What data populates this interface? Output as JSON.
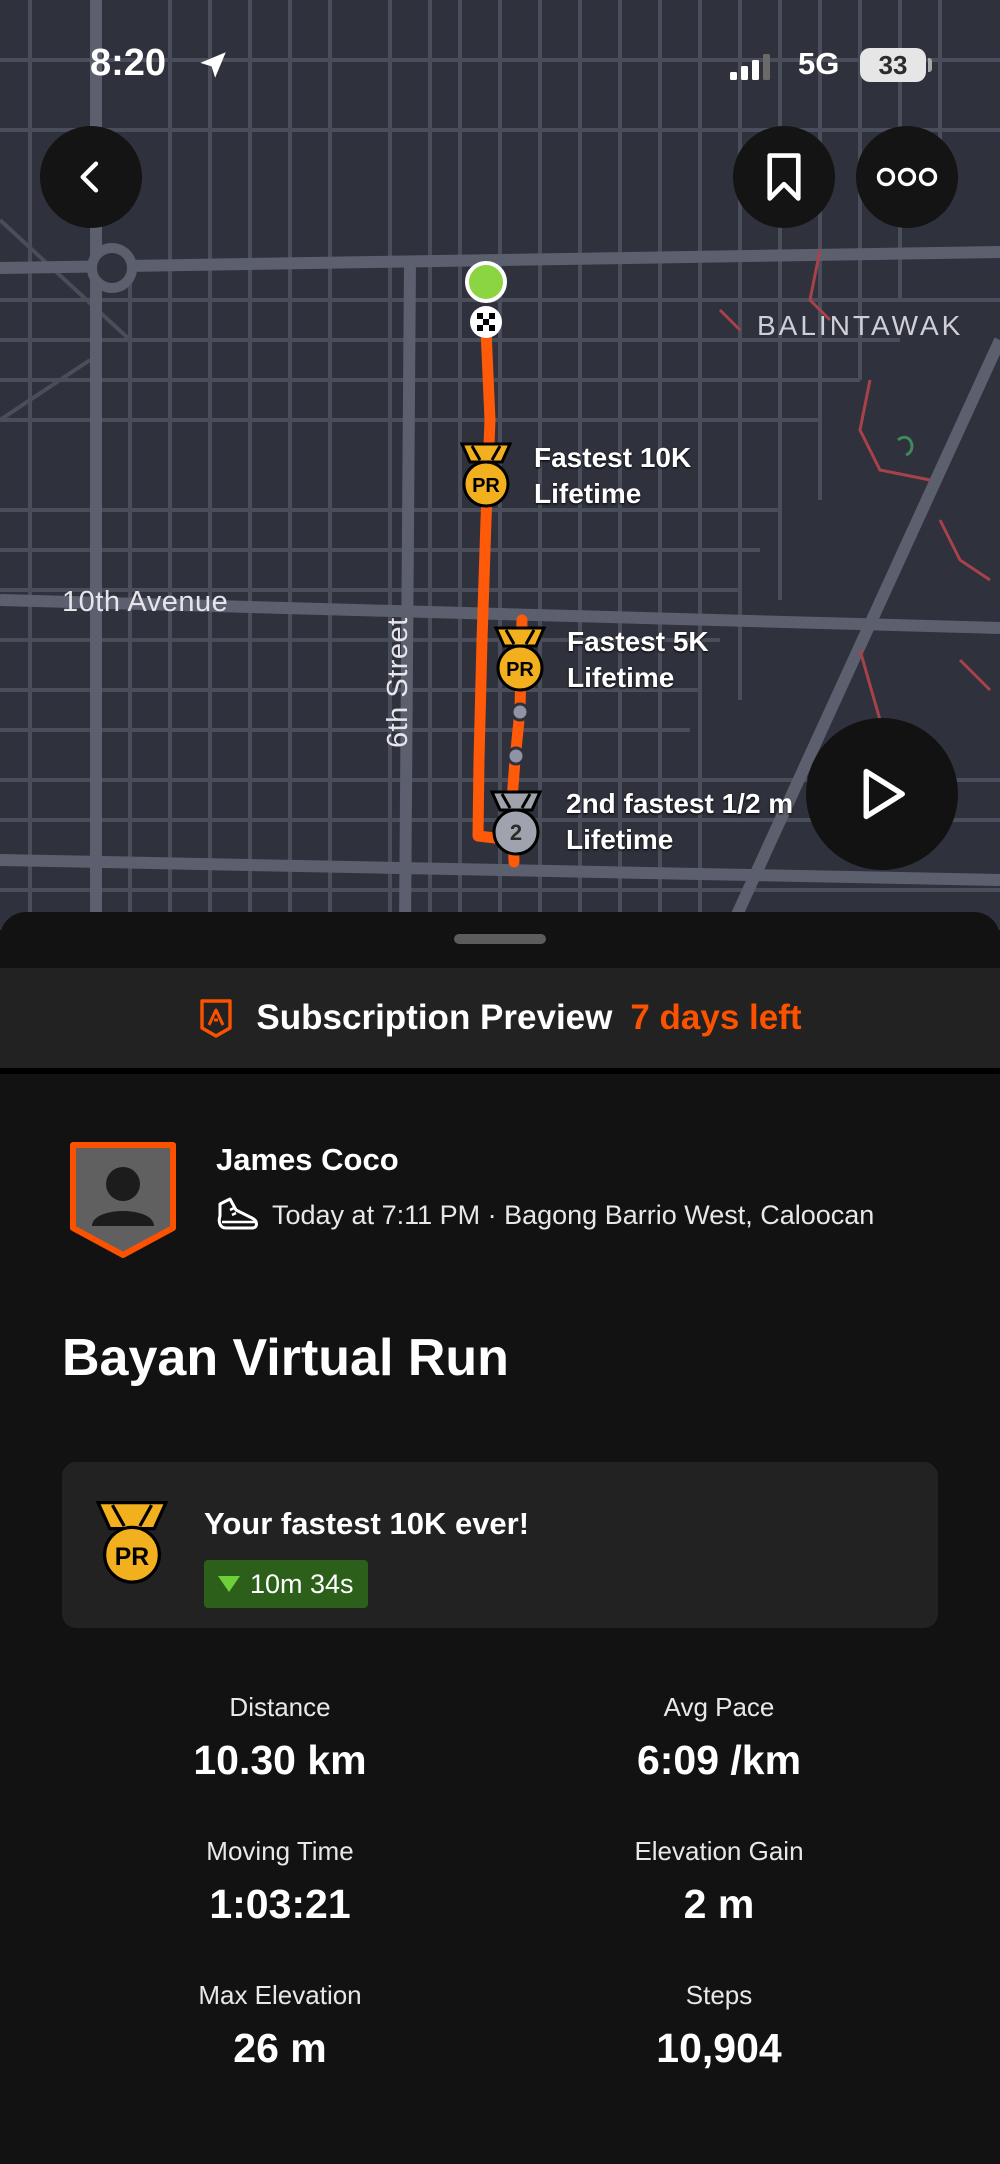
{
  "status_bar": {
    "time": "8:20",
    "network": "5G",
    "battery": "33"
  },
  "map": {
    "labels": {
      "district": "BALINTAWAK",
      "avenue": "10th Avenue",
      "street": "6th Street"
    },
    "segments": [
      {
        "title": "Fastest 10K",
        "subtitle": "Lifetime",
        "medal": "PR"
      },
      {
        "title": "Fastest 5K",
        "subtitle": "Lifetime",
        "medal": "PR"
      },
      {
        "title": "2nd fastest 1/2 m",
        "subtitle": "Lifetime",
        "medal": "2"
      }
    ],
    "buttons": {
      "back": "back-icon",
      "save": "bookmark-icon",
      "more": "more-icon",
      "play": "play-icon"
    }
  },
  "subscription": {
    "title": "Subscription Preview",
    "days_left": "7 days left"
  },
  "athlete": {
    "name": "James Coco",
    "meta": "Today at 7:11 PM · Bagong Barrio West, Caloocan"
  },
  "activity": {
    "title": "Bayan Virtual Run"
  },
  "achievement": {
    "text": "Your fastest 10K ever!",
    "improvement": "10m 34s",
    "medal": "PR"
  },
  "stats": [
    {
      "label": "Distance",
      "value": "10.30 km"
    },
    {
      "label": "Avg Pace",
      "value": "6:09 /km"
    },
    {
      "label": "Moving Time",
      "value": "1:03:21"
    },
    {
      "label": "Elevation Gain",
      "value": "2 m"
    },
    {
      "label": "Max Elevation",
      "value": "26 m"
    },
    {
      "label": "Steps",
      "value": "10,904"
    }
  ],
  "colors": {
    "accent": "#fc5200",
    "route": "#ff5a0a",
    "pr_gold": "#f2b01e",
    "start": "#8bd442",
    "improvement_bg": "#2c5f1a"
  }
}
